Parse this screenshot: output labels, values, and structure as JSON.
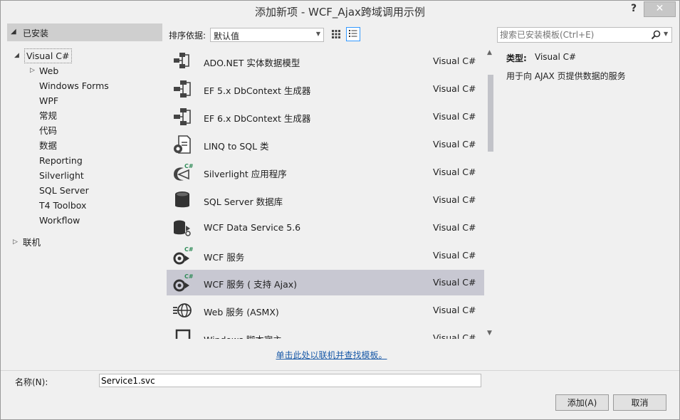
{
  "window": {
    "title": "添加新项 - WCF_Ajax跨域调用示例",
    "help_label": "?",
    "close_label": "✕"
  },
  "left_tree": {
    "installed_label": "已安装",
    "visual_csharp": "Visual C#",
    "items": [
      "Web",
      "Windows Forms",
      "WPF",
      "常规",
      "代码",
      "数据",
      "Reporting",
      "Silverlight",
      "SQL Server",
      "T4 Toolbox",
      "Workflow"
    ],
    "online_label": "联机"
  },
  "toolbar": {
    "sort_label": "排序依据:",
    "sort_value": "默认值",
    "grid_view_icon": "grid-view-icon",
    "list_view_icon": "list-view-icon"
  },
  "search": {
    "placeholder": "搜索已安装模板(Ctrl+E)",
    "icon": "search-icon"
  },
  "templates": [
    {
      "name": "ADO.NET 实体数据模型",
      "lang": "Visual C#",
      "icon": "entity-model-icon"
    },
    {
      "name": "EF 5.x DbContext 生成器",
      "lang": "Visual C#",
      "icon": "ef-generator-icon"
    },
    {
      "name": "EF 6.x DbContext 生成器",
      "lang": "Visual C#",
      "icon": "ef-generator-icon"
    },
    {
      "name": "LINQ to SQL 类",
      "lang": "Visual C#",
      "icon": "linq-to-sql-icon"
    },
    {
      "name": "Silverlight 应用程序",
      "lang": "Visual C#",
      "icon": "silverlight-icon"
    },
    {
      "name": "SQL Server 数据库",
      "lang": "Visual C#",
      "icon": "database-icon"
    },
    {
      "name": "WCF Data Service 5.6",
      "lang": "Visual C#",
      "icon": "data-service-icon"
    },
    {
      "name": "WCF 服务",
      "lang": "Visual C#",
      "icon": "wcf-service-icon"
    },
    {
      "name": "WCF 服务 ( 支持 Ajax)",
      "lang": "Visual C#",
      "icon": "wcf-ajax-service-icon",
      "selected": true
    },
    {
      "name": "Web 服务 (ASMX)",
      "lang": "Visual C#",
      "icon": "web-service-icon"
    },
    {
      "name": "Windows 脚本宿主",
      "lang": "Visual C#",
      "icon": "script-host-icon"
    }
  ],
  "online_link": "单击此处以联机并查找模板。",
  "details": {
    "type_label": "类型:",
    "type_value": "Visual C#",
    "description": "用于向 AJAX 页提供数据的服务"
  },
  "name_field": {
    "label": "名称(N):",
    "value": "Service1.svc"
  },
  "buttons": {
    "add": "添加(A)",
    "cancel": "取消"
  },
  "colors": {
    "selected_row": "#c8c8d2",
    "link": "#1a5aa8",
    "header_bg": "#cfcfcf"
  }
}
